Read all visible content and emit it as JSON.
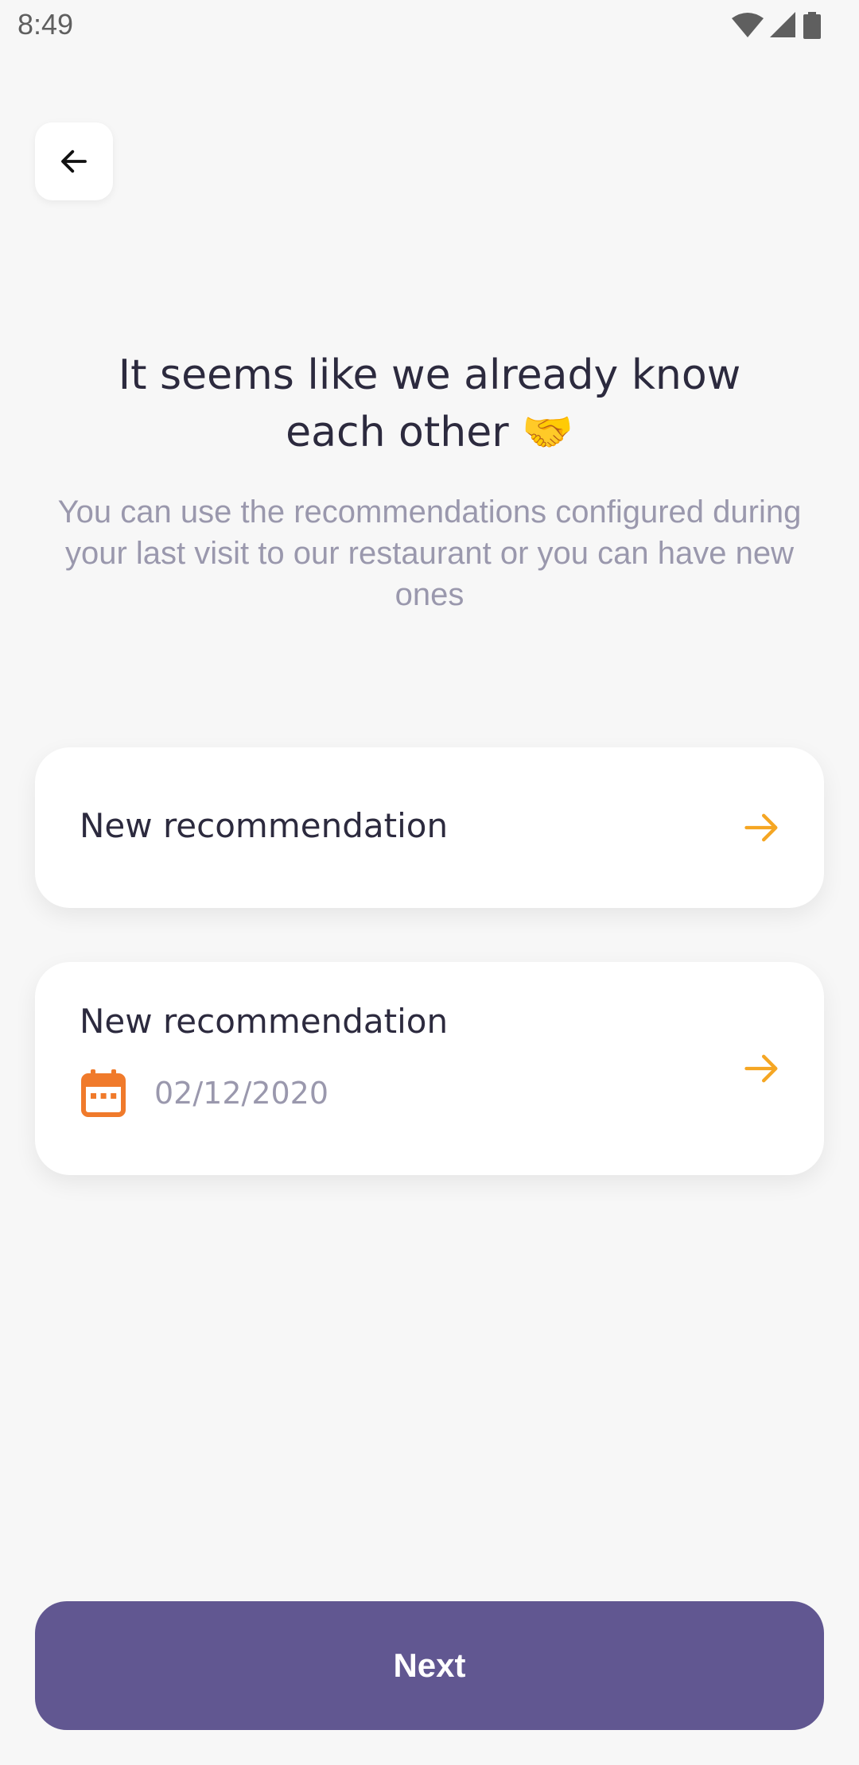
{
  "status_bar": {
    "time": "8:49",
    "icons": [
      "wifi-icon",
      "signal-icon",
      "battery-icon"
    ]
  },
  "header": {
    "back_icon": "arrow-left-icon"
  },
  "main": {
    "title": "It seems like we already know each other 🤝",
    "subtitle": "You can use the recommendations configured during your last visit to our restaurant or you can have new ones"
  },
  "options": [
    {
      "title": "New recommendation",
      "icon": "arrow-right-icon"
    },
    {
      "title": "New recommendation",
      "date": "02/12/2020",
      "date_icon": "calendar-icon",
      "icon": "arrow-right-icon"
    }
  ],
  "footer": {
    "next_label": "Next"
  },
  "colors": {
    "accent": "#F5A623",
    "calendar": "#F07A2B",
    "primary_button": "#615791",
    "background": "#F7F7F7",
    "title_text": "#2C2A3E",
    "muted_text": "#9A98AD"
  }
}
